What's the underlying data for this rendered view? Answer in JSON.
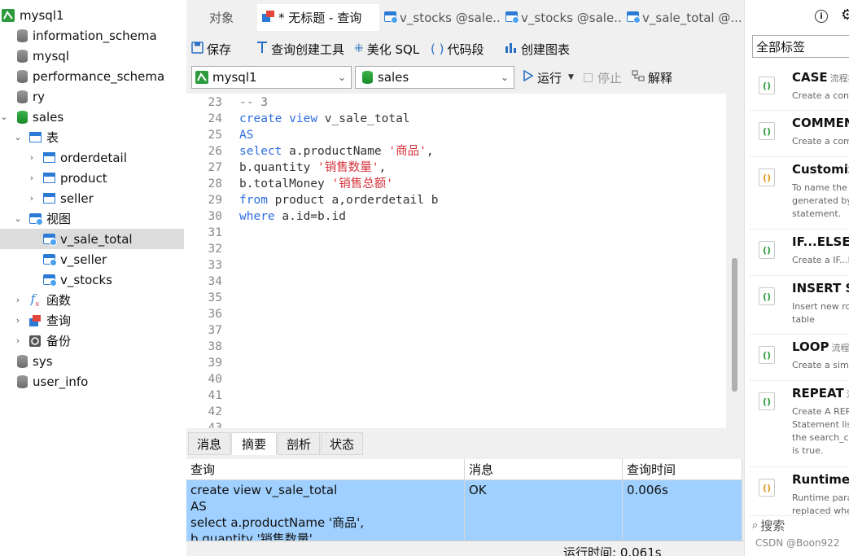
{
  "tree": {
    "connection": "mysql1",
    "databases": [
      "information_schema",
      "mysql",
      "performance_schema",
      "ry"
    ],
    "active_db": "sales",
    "tables_label": "表",
    "tables": [
      "orderdetail",
      "product",
      "seller"
    ],
    "views_label": "视图",
    "views": [
      "v_sale_total",
      "v_seller",
      "v_stocks"
    ],
    "functions_label": "函数",
    "queries_label": "查询",
    "backups_label": "备份",
    "other_dbs": [
      "sys",
      "user_info"
    ]
  },
  "tabs": [
    "对象",
    "* 无标题 - 查询",
    "v_stocks @sale...",
    "v_stocks @sale...",
    "v_sale_total @..."
  ],
  "toolbar": {
    "save": "保存",
    "query_builder": "查询创建工具",
    "beautify": "美化 SQL",
    "snippet": "代码段",
    "chart": "创建图表"
  },
  "selectors": {
    "connection": "mysql1",
    "database": "sales",
    "run": "运行",
    "stop": "停止",
    "explain": "解释"
  },
  "editor": {
    "line_numbers": [
      "23",
      "24",
      "25",
      "26",
      "27",
      "28",
      "29",
      "30",
      "31",
      "32",
      "33",
      "34",
      "35",
      "36",
      "37",
      "38",
      "39",
      "40",
      "41",
      "42",
      "43"
    ],
    "lines": [
      [
        {
          "t": "-- 3",
          "c": "cmt"
        }
      ],
      [
        {
          "t": "create",
          "c": "kw"
        },
        {
          "t": " "
        },
        {
          "t": "view",
          "c": "kw"
        },
        {
          "t": " v_sale_total"
        }
      ],
      [
        {
          "t": "AS",
          "c": "kw"
        }
      ],
      [
        {
          "t": "select",
          "c": "kw"
        },
        {
          "t": " a.productName "
        },
        {
          "t": "'商品'",
          "c": "str"
        },
        {
          "t": ","
        }
      ],
      [
        {
          "t": "b.quantity "
        },
        {
          "t": "'销售数量'",
          "c": "str"
        },
        {
          "t": ","
        }
      ],
      [
        {
          "t": "b.totalMoney "
        },
        {
          "t": "'销售总额'",
          "c": "str"
        }
      ],
      [
        {
          "t": "from",
          "c": "kw"
        },
        {
          "t": " product a,orderdetail b"
        }
      ],
      [
        {
          "t": "where",
          "c": "kw"
        },
        {
          "t": " a.id=b.id"
        }
      ]
    ]
  },
  "result_tabs": [
    "消息",
    "摘要",
    "剖析",
    "状态"
  ],
  "result": {
    "columns": [
      "查询",
      "消息",
      "查询时间"
    ],
    "query_lines": [
      "create view v_sale_total",
      "AS",
      "select a.productName '商品',",
      "b.quantity '销售数量',"
    ],
    "message": "OK",
    "time": "0.006s"
  },
  "status": {
    "runtime": "运行时间: 0.061s"
  },
  "snippets": {
    "filter": "全部标签",
    "search_placeholder": "搜索",
    "items": [
      {
        "title": "CASE",
        "tag": "流程控",
        "desc": [
          "Create a cond"
        ]
      },
      {
        "title": "COMMEN",
        "tag": "",
        "desc": [
          "Create a comm"
        ]
      },
      {
        "title": "Customiz",
        "tag": "",
        "desc": [
          "To name the r",
          "generated by",
          "statement."
        ]
      },
      {
        "title": "IF...ELSE...",
        "tag": "",
        "desc": [
          "Create a IF...EL"
        ]
      },
      {
        "title": "INSERT Sy",
        "tag": "",
        "desc": [
          "Insert new row",
          "table"
        ]
      },
      {
        "title": "LOOP",
        "tag": "流程控",
        "desc": [
          "Create a simp"
        ]
      },
      {
        "title": "REPEAT",
        "tag": "流",
        "desc": [
          "Create A REPE",
          "Statement list",
          "the search_co",
          "is true."
        ]
      },
      {
        "title": "Runtime P",
        "tag": "",
        "desc": [
          "Runtime para",
          "replaced whe"
        ]
      }
    ]
  },
  "watermark": "CSDN @Boon922",
  "colors": {
    "keyword": "#2d6ddf",
    "string": "#d6303a",
    "selected_row": "#9fd0ff",
    "db_active": "#198a2a"
  }
}
